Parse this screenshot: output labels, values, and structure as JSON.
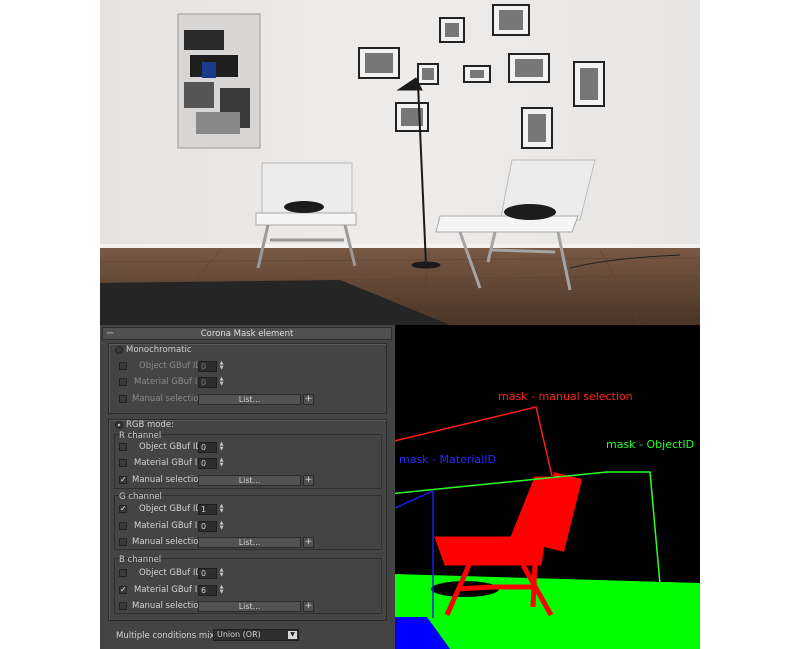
{
  "panel": {
    "title": "Corona Mask element",
    "monochromatic": {
      "label": "Monochromatic",
      "object_gbuf_label": "Object GBuf ID:",
      "object_gbuf_value": "0",
      "material_gbuf_label": "Material GBuf ID:",
      "material_gbuf_value": "0",
      "manual_label": "Manual selection:",
      "list_label": "List...",
      "plus": "+"
    },
    "rgb": {
      "label": "RGB mode:",
      "r": {
        "header": "R channel",
        "object_gbuf_label": "Object GBuf ID:",
        "object_gbuf_value": "0",
        "material_gbuf_label": "Material GBuf ID:",
        "material_gbuf_value": "0",
        "manual_label": "Manual selection:",
        "list_label": "List...",
        "plus": "+"
      },
      "g": {
        "header": "G channel",
        "object_gbuf_label": "Object GBuf ID:",
        "object_gbuf_value": "1",
        "material_gbuf_label": "Material GBuf ID:",
        "material_gbuf_value": "0",
        "manual_label": "Manual selection:",
        "list_label": "List...",
        "plus": "+"
      },
      "b": {
        "header": "B channel",
        "object_gbuf_label": "Object GBuf ID:",
        "object_gbuf_value": "0",
        "material_gbuf_label": "Material GBuf ID:",
        "material_gbuf_value": "6",
        "manual_label": "Manual selection:",
        "list_label": "List...",
        "plus": "+"
      }
    },
    "mixing_label": "Multiple conditions mixing:",
    "mixing_value": "Union (OR)"
  },
  "annotations": {
    "manual": "mask - manual selection",
    "object": "mask - ObjectID",
    "material": "mask - MaterialID"
  },
  "colors": {
    "panel_bg": "#444444",
    "mask_red": "#ff0000",
    "mask_green": "#00ff00",
    "mask_blue": "#0000ff",
    "annotation_blue": "#2222ee"
  },
  "icons": {
    "checkbox_checked": "checkmark",
    "spinner": "up-down-arrows",
    "dropdown": "chevron-down"
  }
}
